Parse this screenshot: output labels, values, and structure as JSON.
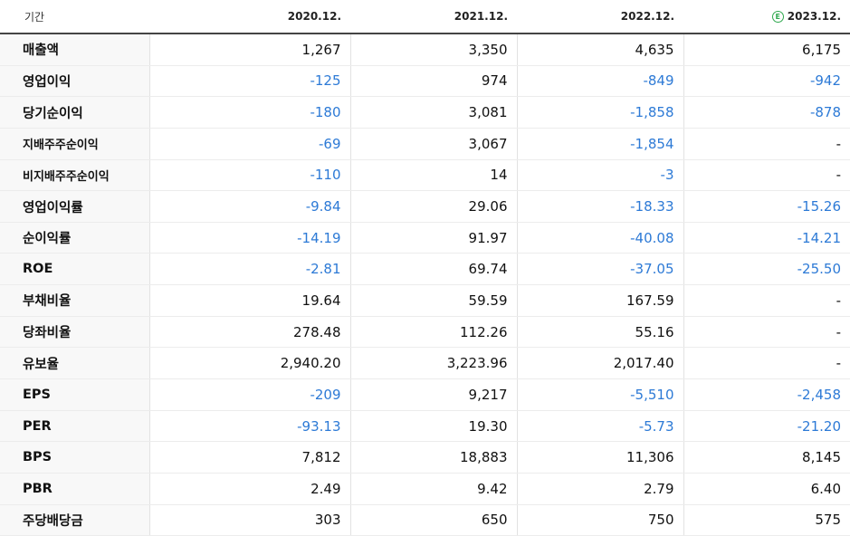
{
  "header": {
    "label": "기간",
    "periods": [
      "2020.12.",
      "2021.12.",
      "2022.12.",
      "2023.12."
    ],
    "estimate_marker": "E"
  },
  "rows": [
    {
      "label": "매출액",
      "values": [
        "1,267",
        "3,350",
        "4,635",
        "6,175"
      ]
    },
    {
      "label": "영업이익",
      "values": [
        "-125",
        "974",
        "-849",
        "-942"
      ]
    },
    {
      "label": "당기순이익",
      "values": [
        "-180",
        "3,081",
        "-1,858",
        "-878"
      ]
    },
    {
      "label": "지배주주순이익",
      "values": [
        "-69",
        "3,067",
        "-1,854",
        "-"
      ]
    },
    {
      "label": "비지배주주순이익",
      "values": [
        "-110",
        "14",
        "-3",
        "-"
      ]
    },
    {
      "label": "영업이익률",
      "values": [
        "-9.84",
        "29.06",
        "-18.33",
        "-15.26"
      ]
    },
    {
      "label": "순이익률",
      "values": [
        "-14.19",
        "91.97",
        "-40.08",
        "-14.21"
      ]
    },
    {
      "label": "ROE",
      "values": [
        "-2.81",
        "69.74",
        "-37.05",
        "-25.50"
      ]
    },
    {
      "label": "부채비율",
      "values": [
        "19.64",
        "59.59",
        "167.59",
        "-"
      ]
    },
    {
      "label": "당좌비율",
      "values": [
        "278.48",
        "112.26",
        "55.16",
        "-"
      ]
    },
    {
      "label": "유보율",
      "values": [
        "2,940.20",
        "3,223.96",
        "2,017.40",
        "-"
      ]
    },
    {
      "label": "EPS",
      "values": [
        "-209",
        "9,217",
        "-5,510",
        "-2,458"
      ]
    },
    {
      "label": "PER",
      "values": [
        "-93.13",
        "19.30",
        "-5.73",
        "-21.20"
      ]
    },
    {
      "label": "BPS",
      "values": [
        "7,812",
        "18,883",
        "11,306",
        "8,145"
      ]
    },
    {
      "label": "PBR",
      "values": [
        "2.49",
        "9.42",
        "2.79",
        "6.40"
      ]
    },
    {
      "label": "주당배당금",
      "values": [
        "303",
        "650",
        "750",
        "575"
      ]
    }
  ],
  "colors": {
    "negative": "#2d7ad6",
    "estimate_icon": "#2fa94e"
  }
}
